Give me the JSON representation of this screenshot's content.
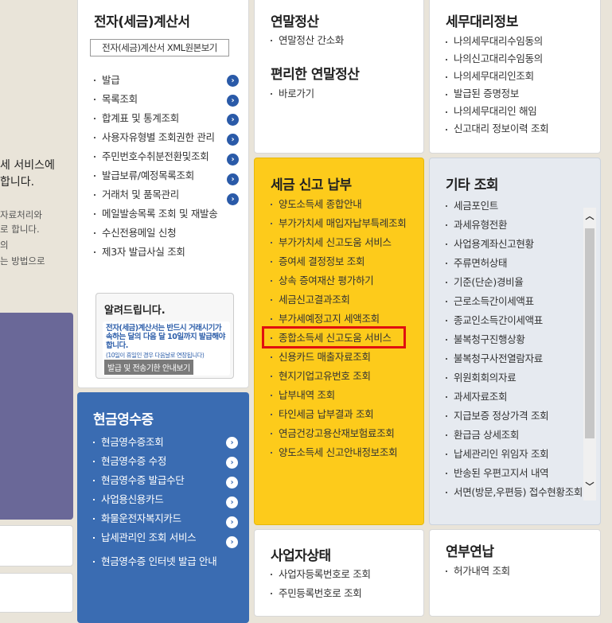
{
  "left_partial": {
    "line1": "세 서비스에",
    "line2": "합니다.",
    "line3": "자료처리와",
    "line4": "로 합니다.",
    "line5": "의",
    "line6": "는 방법으로"
  },
  "tax_invoice": {
    "title": "전자(세금)계산서",
    "xml_button": "전자(세금)계산서 XML원본보기",
    "items": [
      "발급",
      "목록조회",
      "합계표 및 통계조회",
      "사용자유형별 조회권한 관리",
      "주민번호수취분전환및조회",
      "발급보류/예정목록조회",
      "거래처 및 품목관리",
      "메일발송목록 조회 및 재발송",
      "수신전용메일 신청",
      "제3자 발급사실 조회"
    ],
    "notice": {
      "title": "알려드립니다.",
      "body": "전자(세금)계산서는 반드시 거래시기가 속하는 달의 다음 달 10일까지 발급해야 합니다.",
      "small": "(10일이 휴일인 경우 다음날로 연장됩니다)",
      "button": "발급 및 전송기한 안내보기"
    }
  },
  "cash_receipt": {
    "title": "현금영수증",
    "items": [
      "현금영수증조회",
      "현금영수증 수정",
      "현금영수증 발급수단",
      "사업용신용카드",
      "화물운전자복지카드",
      "납세관리인 조회 서비스",
      "현금영수증 인터넷 발급 안내"
    ]
  },
  "year_end": {
    "title": "연말정산",
    "items": [
      "연말정산 간소화"
    ],
    "title2": "편리한 연말정산",
    "items2": [
      "바로가기"
    ]
  },
  "tax_filing": {
    "title": "세금 신고 납부",
    "items": [
      "양도소득세 종합안내",
      "부가가치세 매입자납부특례조회",
      "부가가치세 신고도움 서비스",
      "증여세 결정정보 조회",
      "상속 증여재산 평가하기",
      "세금신고결과조회",
      "부가세예정고지 세액조회",
      "종합소득세 신고도움 서비스",
      "신용카드 매출자료조회",
      "현지기업고유번호 조회",
      "납부내역 조회",
      "타인세금 납부결과 조회",
      "연금건강고용산재보험료조회",
      "양도소득세 신고안내정보조회"
    ]
  },
  "tax_agent": {
    "title": "세무대리정보",
    "items": [
      "나의세무대리수임동의",
      "나의신고대리수임동의",
      "나의세무대리인조회",
      "발급된 증명정보",
      "나의세무대리인 해임",
      "신고대리 정보이력 조회"
    ]
  },
  "other": {
    "title": "기타 조회",
    "items": [
      "세금포인트",
      "과세유형전환",
      "사업용계좌신고현황",
      "주류면허상태",
      "기준(단순)경비율",
      "근로소득간이세액표",
      "종교인소득간이세액표",
      "불복청구진행상황",
      "불복청구사전열람자료",
      "위원회회의자료",
      "과세자료조회",
      "지급보증 정상가격 조회",
      "환급금 상세조회",
      "납세관리인 위임자 조회",
      "반송된 우편고지서 내역",
      "서면(방문,우편등) 접수현황조회"
    ]
  },
  "business_status": {
    "title": "사업자상태",
    "items": [
      "사업자등록번호로 조회",
      "주민등록번호로 조회"
    ]
  },
  "pension": {
    "title": "연부연납",
    "items": [
      "허가내역 조회"
    ]
  },
  "colors": {
    "yellow": "#fdcb1b",
    "blue": "#3a6cb2",
    "highlight": "#e01010"
  }
}
